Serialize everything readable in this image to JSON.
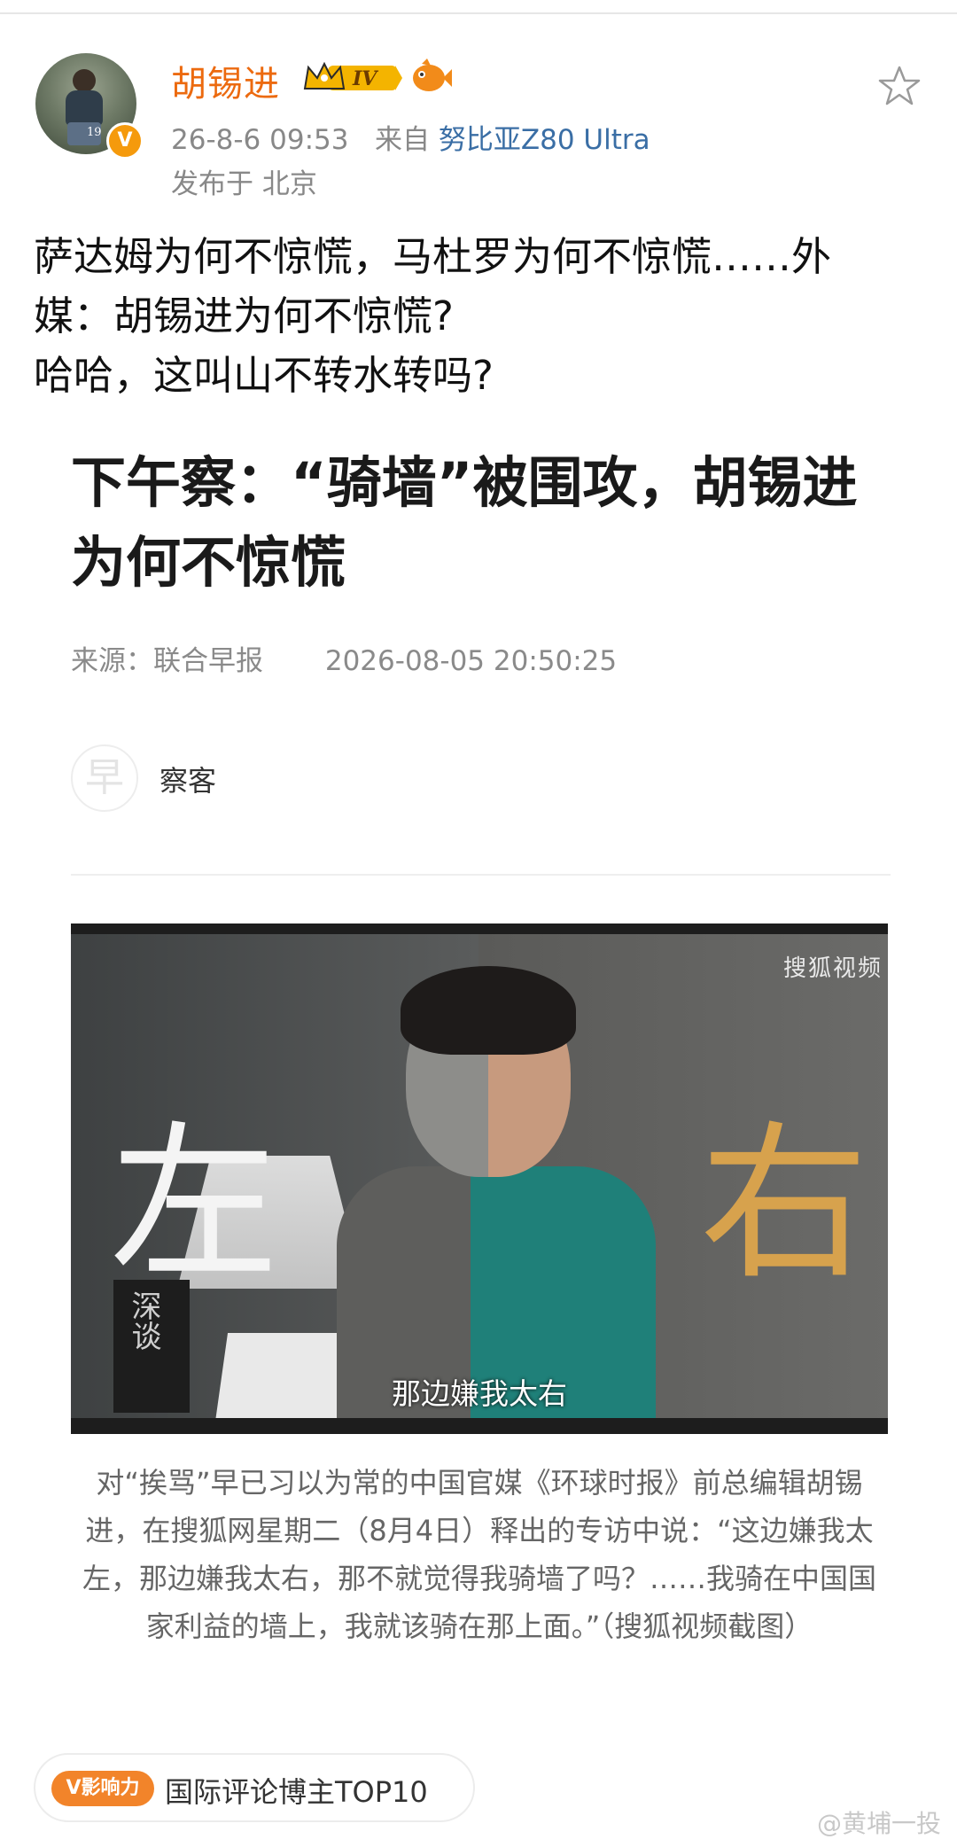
{
  "post": {
    "username": "胡锡进",
    "level_badge": "IV",
    "time": "26-8-6 09:53",
    "from_label": "来自",
    "device": "努比亚Z80 Ultra",
    "location": "发布于 北京",
    "text_line1": "萨达姆为何不惊慌，马杜罗为何不惊慌……外",
    "text_line2": "媒：胡锡进为何不惊慌?",
    "text_line3": "哈哈，这叫山不转水转吗?",
    "avatar_stamp": "19"
  },
  "article": {
    "title_line1": "下午察：“骑墙”被围攻，胡锡进",
    "title_line2": "为何不惊慌",
    "source": "来源：联合早报",
    "datetime": "2026-08-05 20:50:25",
    "logo_char": "早",
    "author": "察客",
    "video": {
      "char_left": "左",
      "char_right": "右",
      "watermark": "搜狐视频",
      "subtitle": "那边嫌我太右",
      "book_text": "深谈"
    },
    "caption": "对“挨骂”早已习以为常的中国官媒《环球时报》前总编辑胡锡进，在搜狐网星期二（8月4日）释出的专访中说：“这边嫌我太左，那边嫌我太右，那不就觉得我骑墙了吗？……我骑在中国国家利益的墙上，我就该骑在那上面。”（搜狐视频截图）"
  },
  "footer": {
    "influence_pill": "V影响力",
    "influence_text": "国际评论博主TOP10",
    "watermark": "@黄埔一投"
  },
  "colors": {
    "username": "#ec6a0f",
    "device_link": "#3a6ea5",
    "verified": "#f59a0c",
    "influence": "#f2842a"
  },
  "icons": [
    "star-icon",
    "crown-badge-icon",
    "fish-icon",
    "verified-icon"
  ]
}
